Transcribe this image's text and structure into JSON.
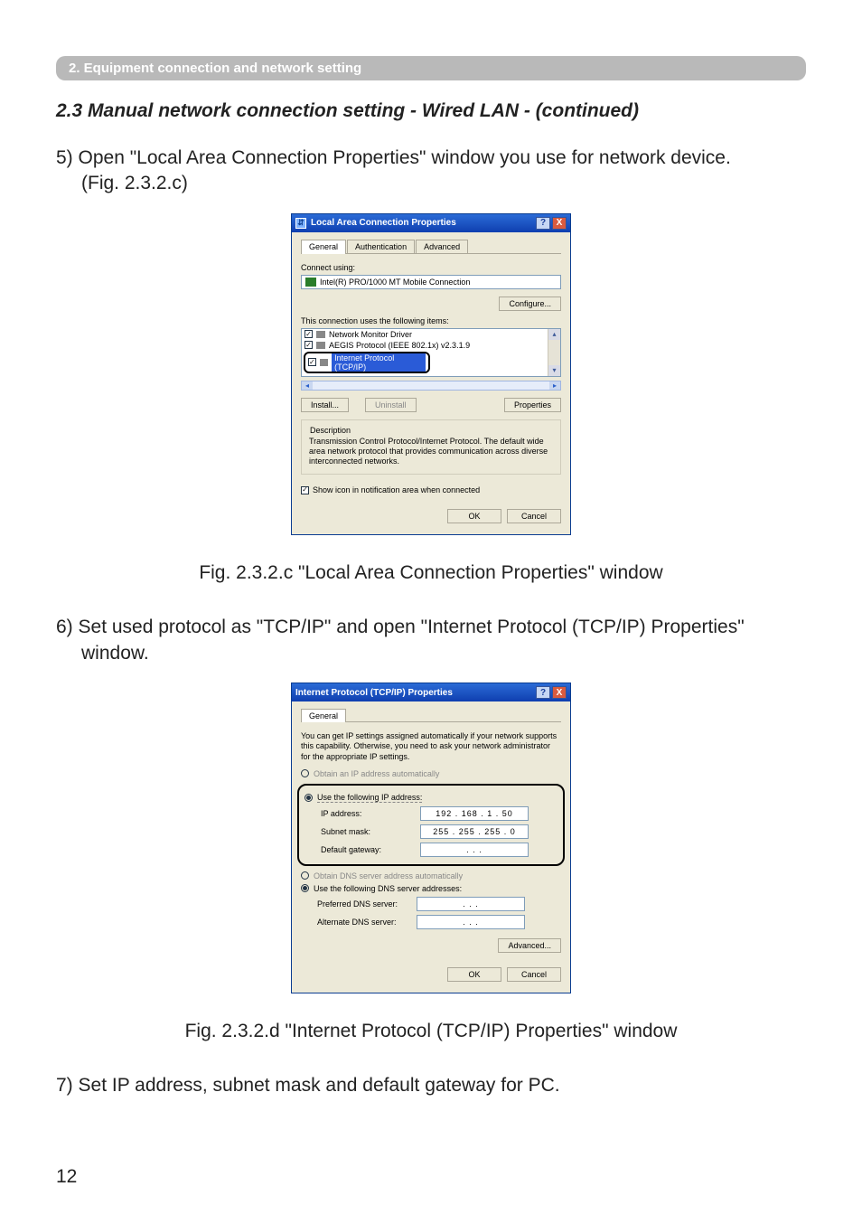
{
  "section_bar": "2. Equipment connection and network setting",
  "heading": "2.3 Manual network connection setting - Wired LAN - (continued)",
  "body_5_a": "5) Open \"Local Area Connection Properties\" window you use for network device.",
  "body_5_b": "(Fig. 2.3.2.c)",
  "fig1_caption": "Fig. 2.3.2.c \"Local Area Connection Properties\" window",
  "body_6_a": "6) Set used protocol as \"TCP/IP\" and open \"Internet Protocol (TCP/IP) Properties\"",
  "body_6_b": "window.",
  "fig2_caption": "Fig. 2.3.2.d \"Internet Protocol (TCP/IP) Properties\" window",
  "body_7": "7) Set IP address, subnet mask and default gateway for PC.",
  "page_number": "12",
  "dlg1": {
    "title": "Local Area Connection Properties",
    "help": "?",
    "close": "X",
    "tabs": {
      "general": "General",
      "auth": "Authentication",
      "adv": "Advanced"
    },
    "connect_using": "Connect using:",
    "adapter": "Intel(R) PRO/1000 MT Mobile Connection",
    "configure": "Configure...",
    "uses_items": "This connection uses the following items:",
    "items": {
      "a": "Network Monitor Driver",
      "b": "AEGIS Protocol (IEEE 802.1x) v2.3.1.9",
      "c": "Internet Protocol (TCP/IP)"
    },
    "install": "Install...",
    "uninstall": "Uninstall",
    "properties": "Properties",
    "desc_legend": "Description",
    "desc_text": "Transmission Control Protocol/Internet Protocol. The default wide area network protocol that provides communication across diverse interconnected networks.",
    "show_icon": "Show icon in notification area when connected",
    "ok": "OK",
    "cancel": "Cancel"
  },
  "dlg2": {
    "title": "Internet Protocol (TCP/IP) Properties",
    "help": "?",
    "close": "X",
    "tab_general": "General",
    "note": "You can get IP settings assigned automatically if your network supports this capability. Otherwise, you need to ask your network administrator for the appropriate IP settings.",
    "obtain_ip": "Obtain an IP address automatically",
    "use_ip": "Use the following IP address:",
    "ip_label": "IP address:",
    "ip_value": "192 . 168 .  1  . 50",
    "subnet_label": "Subnet mask:",
    "subnet_value": "255 . 255 . 255 .  0",
    "gateway_label": "Default gateway:",
    "gateway_value": " .       .       . ",
    "obtain_dns": "Obtain DNS server address automatically",
    "use_dns": "Use the following DNS server addresses:",
    "pref_dns": "Preferred DNS server:",
    "alt_dns": "Alternate DNS server:",
    "dns_empty": " .       .       . ",
    "advanced": "Advanced...",
    "ok": "OK",
    "cancel": "Cancel"
  }
}
